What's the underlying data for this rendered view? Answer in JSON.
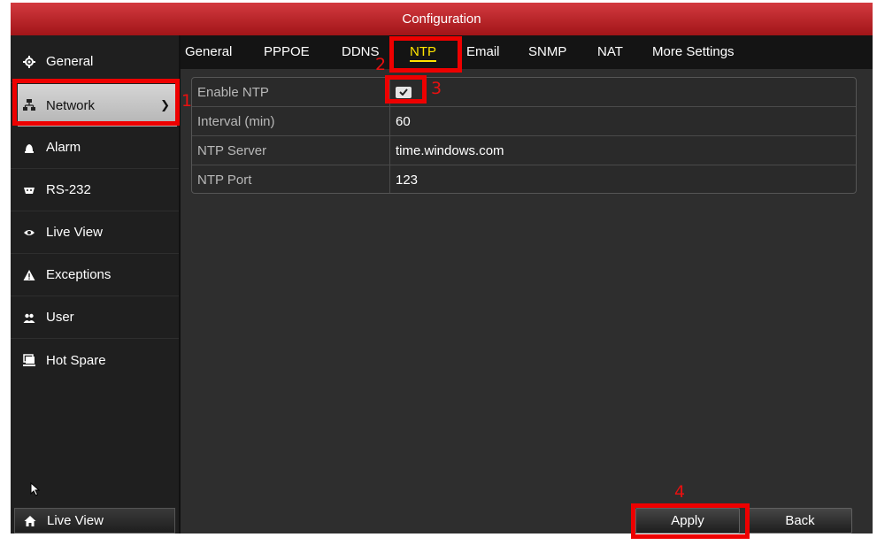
{
  "window": {
    "title": "Configuration"
  },
  "sidebar": {
    "items": [
      {
        "label": "General",
        "icon": "gear-icon"
      },
      {
        "label": "Network",
        "icon": "network-icon",
        "active": true
      },
      {
        "label": "Alarm",
        "icon": "alarm-icon"
      },
      {
        "label": "RS-232",
        "icon": "serial-port-icon"
      },
      {
        "label": "Live View",
        "icon": "eye-icon"
      },
      {
        "label": "Exceptions",
        "icon": "warning-icon"
      },
      {
        "label": "User",
        "icon": "users-icon"
      },
      {
        "label": "Hot Spare",
        "icon": "hot-spare-icon"
      }
    ],
    "bottom_button": {
      "label": "Live View",
      "icon": "home-icon"
    }
  },
  "tabs": [
    "General",
    "PPPOE",
    "DDNS",
    "NTP",
    "Email",
    "SNMP",
    "NAT",
    "More Settings"
  ],
  "active_tab": "NTP",
  "settings": [
    {
      "label": "Enable NTP",
      "type": "checkbox",
      "checked": true
    },
    {
      "label": "Interval (min)",
      "value": "60"
    },
    {
      "label": "NTP Server",
      "value": "time.windows.com"
    },
    {
      "label": "NTP Port",
      "value": "123"
    }
  ],
  "buttons": {
    "apply": "Apply",
    "back": "Back"
  },
  "annotations": [
    "1",
    "2",
    "3",
    "4"
  ],
  "colors": {
    "title_bar": "#c0262b",
    "active_tab": "#ffe400",
    "annotation": "#ee0000"
  }
}
